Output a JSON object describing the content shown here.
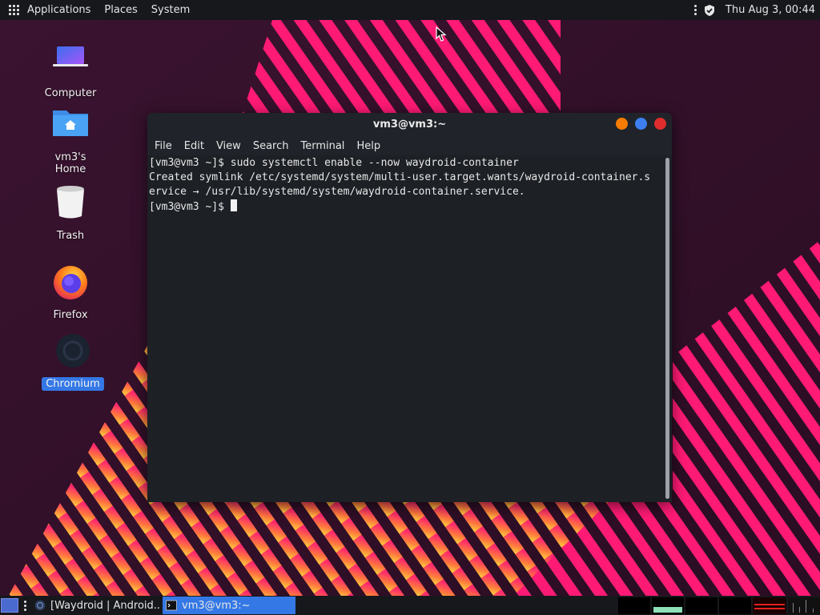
{
  "top_panel": {
    "menus": [
      "Applications",
      "Places",
      "System"
    ],
    "clock": "Thu Aug  3, 00:44",
    "icons": [
      "apps-grid-icon",
      "overflow-menu-icon",
      "shield-check-icon"
    ]
  },
  "desktop": {
    "icons": [
      {
        "label": "Computer",
        "icon": "laptop-icon"
      },
      {
        "label": "vm3's Home",
        "icon": "home-folder-icon"
      },
      {
        "label": "Trash",
        "icon": "trash-icon"
      },
      {
        "label": "Firefox",
        "icon": "firefox-icon"
      },
      {
        "label": "Chromium",
        "icon": "chromium-icon",
        "selected": true
      }
    ]
  },
  "terminal": {
    "title": "vm3@vm3:~",
    "menu": [
      "File",
      "Edit",
      "View",
      "Search",
      "Terminal",
      "Help"
    ],
    "lines": [
      "[vm3@vm3 ~]$ sudo systemctl enable --now waydroid-container",
      "Created symlink /etc/systemd/system/multi-user.target.wants/waydroid-container.s",
      "ervice → /usr/lib/systemd/system/waydroid-container.service.",
      "[vm3@vm3 ~]$ "
    ],
    "window_buttons": {
      "minimize": "#f57c00",
      "maximize": "#3d7ff0",
      "close": "#e02c2c"
    }
  },
  "taskbar": {
    "tasks": [
      {
        "label": "[Waydroid | Android...",
        "icon": "chromium-icon",
        "active": false
      },
      {
        "label": "vm3@vm3:~",
        "icon": "terminal-icon",
        "active": true
      }
    ]
  },
  "colors": {
    "accent": "#3478e6",
    "panel": "#16181c",
    "terminal_bg": "#1d2025",
    "wallpaper_bg": "#2a0f24",
    "stripe_pink": "#ff1a75",
    "stripe_orange": "#ff8a3d"
  }
}
